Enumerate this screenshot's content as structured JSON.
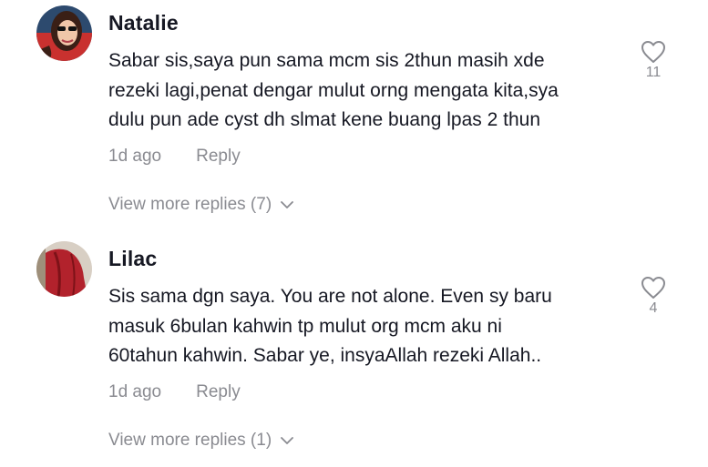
{
  "comments": [
    {
      "username": "Natalie",
      "text": "Sabar sis,saya pun sama mcm sis 2thun masih xde\nrezeki lagi,penat dengar mulut orng mengata kita,sya\ndulu pun ade cyst dh slmat kene buang lpas 2 thun",
      "time": "1d ago",
      "reply_label": "Reply",
      "view_more": "View more replies (7)",
      "likes": "11",
      "avatar_icon": "user-avatar-photo"
    },
    {
      "username": "Lilac",
      "text": "Sis sama dgn saya. You are not alone. Even sy baru\nmasuk 6bulan kahwin tp mulut org mcm aku ni\n60tahun kahwin. Sabar ye, insyaAllah rezeki Allah..",
      "time": "1d ago",
      "reply_label": "Reply",
      "view_more": "View more replies (1)",
      "likes": "4",
      "avatar_icon": "user-avatar-photo"
    }
  ],
  "colors": {
    "text": "#161823",
    "muted": "#8a8b91",
    "background": "#ffffff"
  }
}
